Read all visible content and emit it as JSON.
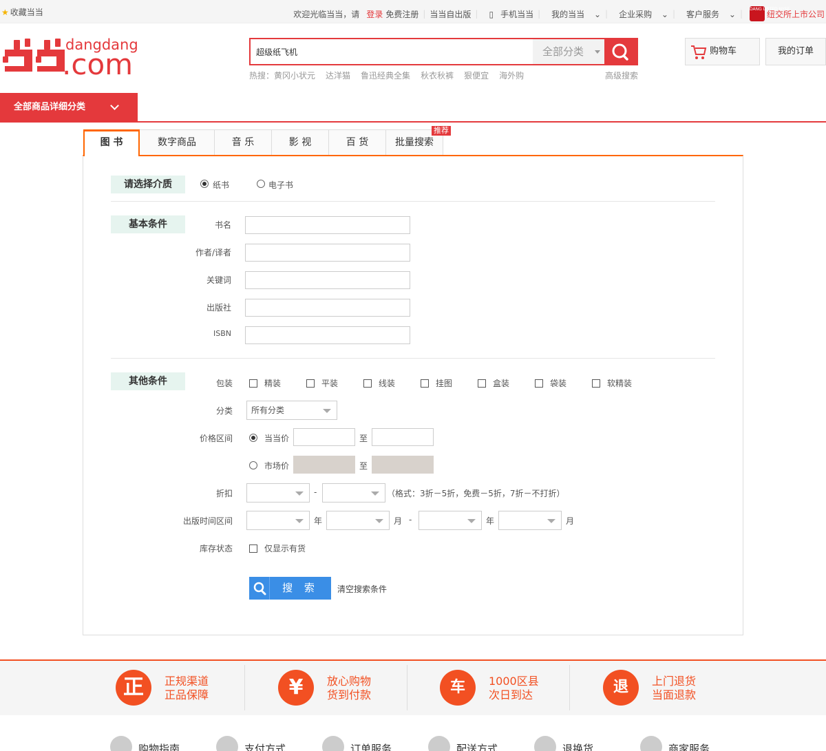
{
  "topbar": {
    "favorite": "收藏当当",
    "welcome": "欢迎光临当当，请",
    "login": "登录",
    "register": "免费注册",
    "self_publish": "当当自出版",
    "mobile": "手机当当",
    "my_dangdang": "我的当当",
    "enterprise": "企业采购",
    "service": "客户服务",
    "listed": "纽交所上市公司",
    "nyse_icon_text": "DANG LISTED NYSE"
  },
  "header": {
    "logo_top": "dangdang",
    "logo_bottom": ".com",
    "search_value": "超级纸飞机",
    "category": "全部分类",
    "hot_label": "热搜：",
    "hotwords": [
      "黄冈小状元",
      "达洋猫",
      "鲁迅经典全集",
      "秋衣秋裤",
      "狠便宜",
      "海外购"
    ],
    "advanced_search": "高级搜索",
    "cart": "购物车",
    "orders": "我的订单"
  },
  "categories": {
    "all": "全部商品详细分类"
  },
  "tabs": [
    {
      "label": "图 书"
    },
    {
      "label": "数字商品"
    },
    {
      "label": "音 乐"
    },
    {
      "label": "影 视"
    },
    {
      "label": "百 货"
    },
    {
      "label": "批量搜索",
      "badge": "推荐"
    }
  ],
  "form": {
    "medium_title": "请选择介质",
    "medium_options": [
      "纸书",
      "电子书"
    ],
    "basic_title": "基本条件",
    "basic_fields": [
      "书名",
      "作者/译者",
      "关键词",
      "出版社",
      "ISBN"
    ],
    "other_title": "其他条件",
    "binding_label": "包装",
    "bindings": [
      "精装",
      "平装",
      "线装",
      "挂图",
      "盒装",
      "袋装",
      "软精装"
    ],
    "category_label": "分类",
    "category_value": "所有分类",
    "price_label": "价格区间",
    "price_current": "当当价",
    "price_market": "市场价",
    "to": "至",
    "discount_label": "折扣",
    "dash": "-",
    "discount_hint": "（格式：3折－5折，免费－5折，7折－不打折）",
    "pubdate_label": "出版时间区间",
    "year": "年",
    "month": "月",
    "stock_label": "库存状态",
    "stock_option": "仅显示有货",
    "search_button": "搜 索",
    "clear": "清空搜索条件"
  },
  "assurance": [
    {
      "glyph": "正",
      "line1": "正规渠道",
      "line2": "正品保障"
    },
    {
      "glyph": "¥",
      "line1": "放心购物",
      "line2": "货到付款"
    },
    {
      "glyph": "车",
      "line1": "1000区县",
      "line2": "次日到达"
    },
    {
      "glyph": "退",
      "line1": "上门退货",
      "line2": "当面退款"
    }
  ],
  "guide": [
    "购物指南",
    "支付方式",
    "订单服务",
    "配送方式",
    "退换货",
    "商家服务"
  ],
  "colors": {
    "brand_red": "#e4393c",
    "accent_orange": "#f25022",
    "tab_orange": "#ff6600",
    "search_blue": "#3a8ee6"
  }
}
